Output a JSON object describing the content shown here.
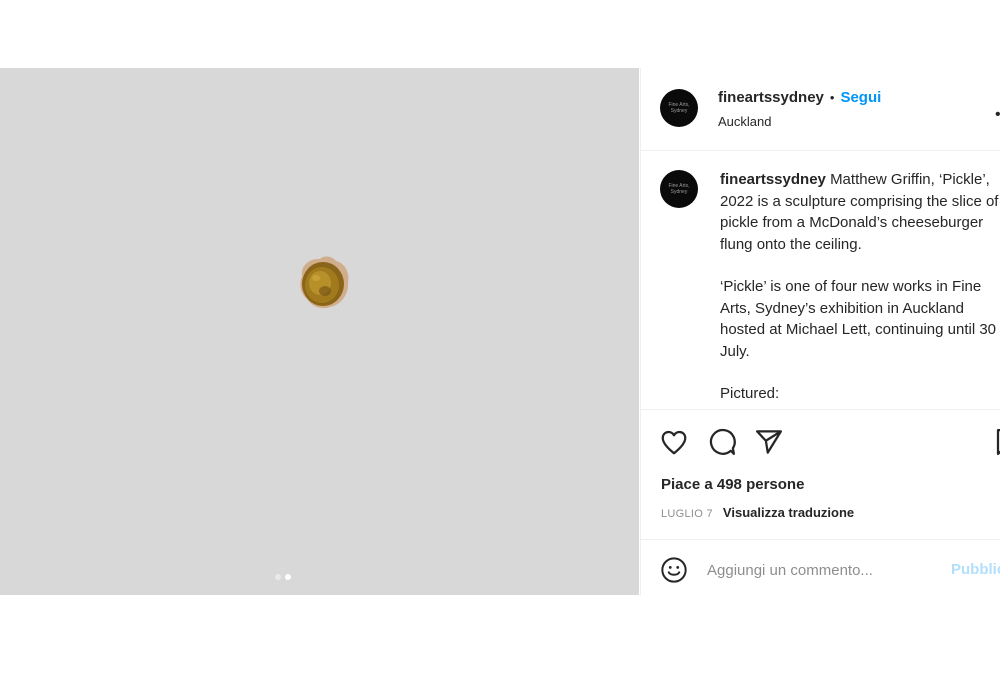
{
  "account": {
    "username": "fineartssydney",
    "separator": "•",
    "follow_label": "Segui",
    "location": "Auckland",
    "avatar_text": "Fine Arts, Sydney",
    "more_icon": "more-horizontal-icon"
  },
  "caption": {
    "username": "fineartssydney",
    "paragraphs": [
      "Matthew Griffin, ‘Pickle’, 2022 is a sculpture comprising the slice of pickle from a McDonald’s cheeseburger flung onto the ceiling.",
      "‘Pickle’ is one of four new works in Fine Arts, Sydney’s exhibition in Auckland hosted at Michael Lett, continuing until 30 July.",
      "Pictured:"
    ]
  },
  "media": {
    "carousel_count": 2,
    "active_index": 1,
    "background_color": "#d9d8d9"
  },
  "actions": {
    "icons": [
      "heart-icon",
      "comment-icon",
      "share-icon",
      "bookmark-icon"
    ]
  },
  "likes_text": "Piace a 498 persone",
  "date_text": "LUGLIO 7",
  "translate_label": "Visualizza traduzione",
  "comment": {
    "emoji_icon": "smiley-icon",
    "placeholder": "Aggiungi un commento...",
    "value": "",
    "publish_label": "Pubblica"
  },
  "colors": {
    "accent": "#0095f6",
    "publish_disabled": "#b2dffc",
    "text": "#262626",
    "muted": "#8e8e8e",
    "divider": "#efefef"
  }
}
